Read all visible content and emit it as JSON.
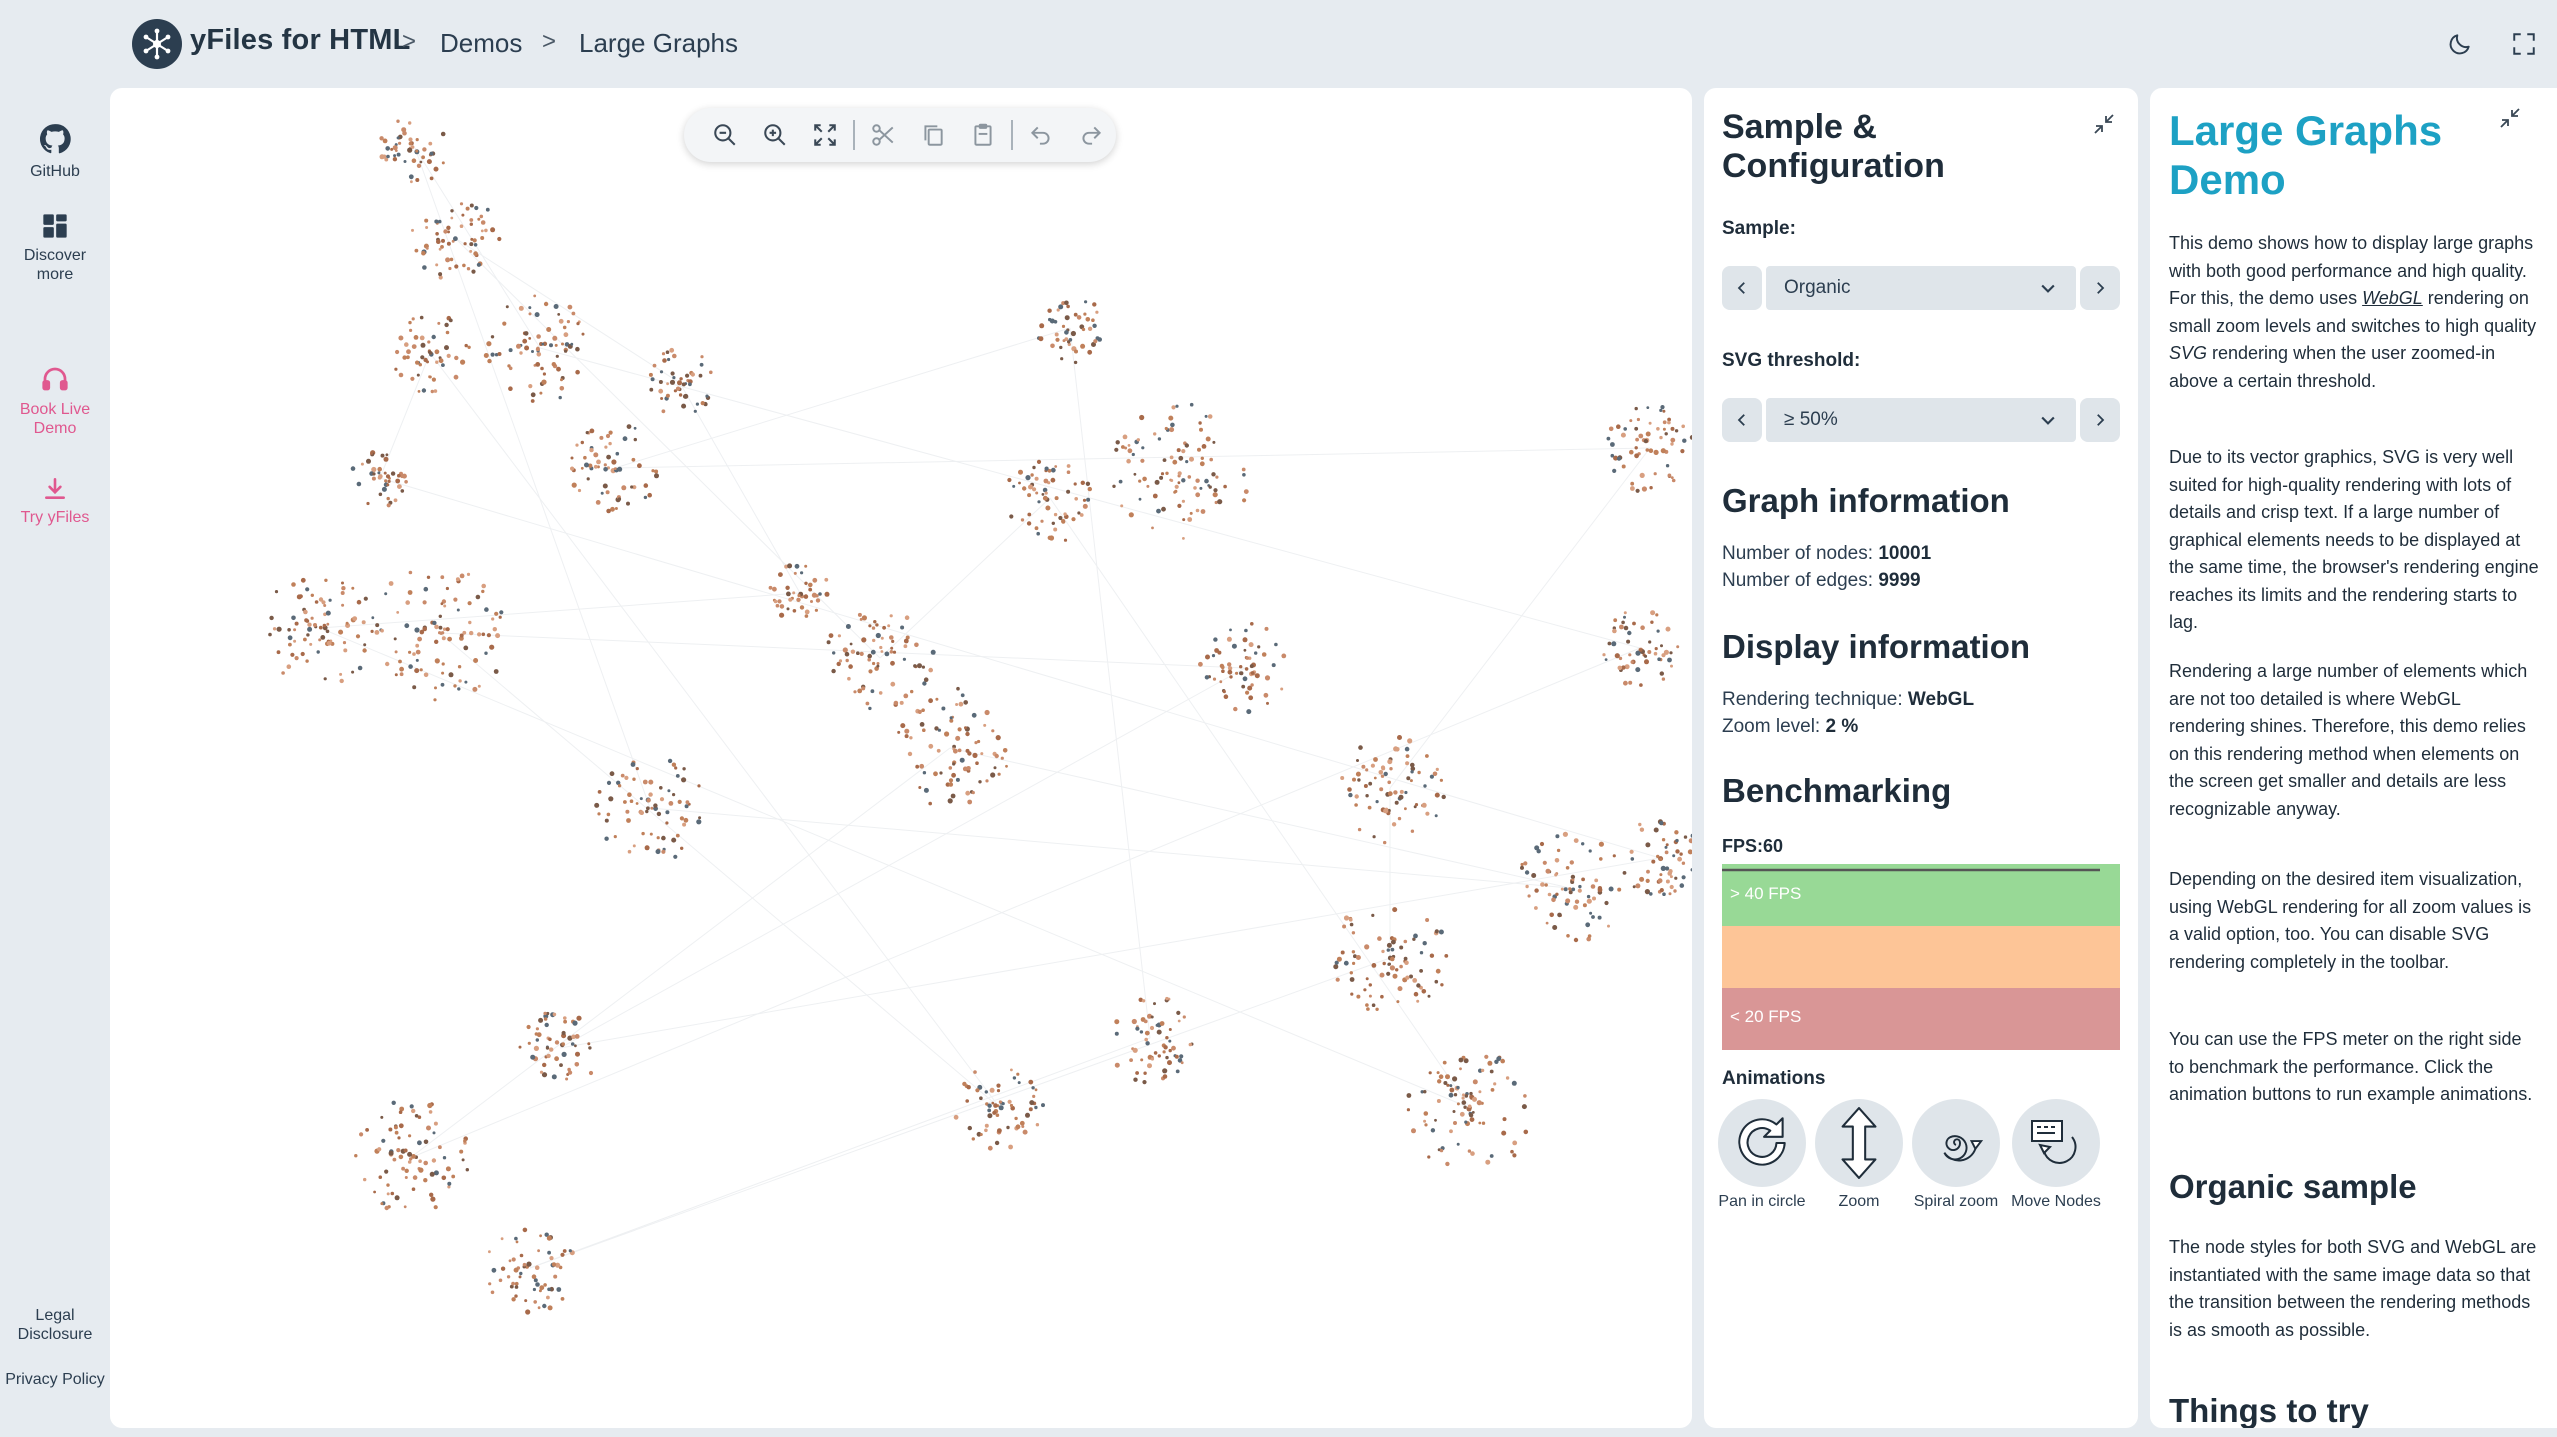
{
  "header": {
    "brand": "yFiles for HTML",
    "breadcrumbs": [
      "Demos",
      "Large Graphs"
    ],
    "separator": ">"
  },
  "rail": {
    "items": [
      {
        "label": "GitHub",
        "icon": "github-icon"
      },
      {
        "label": "Discover more",
        "icon": "grid-icon"
      },
      {
        "label": "Book Live Demo",
        "icon": "headset-icon"
      },
      {
        "label": "Try yFiles",
        "icon": "download-icon"
      }
    ],
    "footer": [
      {
        "label": "Legal Disclosure"
      },
      {
        "label": "Privacy Policy"
      }
    ]
  },
  "toolbar": {
    "buttons": [
      "zoom-out-icon",
      "zoom-in-icon",
      "fit-content-icon",
      "cut-icon",
      "copy-icon",
      "paste-icon",
      "undo-icon",
      "redo-icon"
    ]
  },
  "config": {
    "title": "Sample & Configuration",
    "sample_label": "Sample:",
    "sample_value": "Organic",
    "threshold_label": "SVG threshold:",
    "threshold_value": "≥ 50%",
    "graph_info_title": "Graph information",
    "nodes_label": "Number of nodes:",
    "nodes_value": "10001",
    "edges_label": "Number of edges:",
    "edges_value": "9999",
    "display_info_title": "Display information",
    "technique_label": "Rendering technique:",
    "technique_value": "WebGL",
    "zoom_label": "Zoom level:",
    "zoom_value": "2 %",
    "bench_title": "Benchmarking",
    "fps_label": "FPS:60",
    "fps_high": "> 40 FPS",
    "fps_low": "< 20 FPS",
    "animations_label": "Animations",
    "animations": [
      {
        "label": "Pan in circle",
        "icon": "pan-circle-icon"
      },
      {
        "label": "Zoom",
        "icon": "zoom-arrows-icon"
      },
      {
        "label": "Spiral zoom",
        "icon": "spiral-icon"
      },
      {
        "label": "Move Nodes",
        "icon": "move-nodes-icon"
      }
    ]
  },
  "description": {
    "title": "Large Graphs Demo",
    "p1_a": "This demo shows how to display large graphs with both good performance and high quality. For this, the demo uses ",
    "p1_webgl": "WebGL",
    "p1_b": " rendering on small zoom levels and switches to high quality ",
    "p1_svg": "SVG",
    "p1_c": " rendering when the user zoomed-in above a certain threshold.",
    "p2": "Due to its vector graphics, SVG is very well suited for high-quality rendering with lots of details and crisp text. If a large number of graphical elements needs to be displayed at the same time, the browser's rendering engine reaches its limits and the rendering starts to lag.",
    "p3": "Rendering a large number of elements which are not too detailed is where WebGL rendering shines. Therefore, this demo relies on this rendering method when elements on the screen get smaller and details are less recognizable anyway.",
    "p4": "Depending on the desired item visualization, using WebGL rendering for all zoom values is a valid option, too. You can disable SVG rendering completely in the toolbar.",
    "p5": "You can use the FPS meter on the right side to benchmark the performance. Click the animation buttons to run example animations.",
    "h_organic": "Organic sample",
    "p6": "The node styles for both SVG and WebGL are instantiated with the same image data so that the transition between the rendering methods is as smooth as possible.",
    "h_things": "Things to try"
  },
  "colors": {
    "accent": "#1da1c4",
    "pink": "#e0588f",
    "fps_green": "#98d996",
    "fps_orange": "#fdc597",
    "fps_red": "#d99696"
  }
}
